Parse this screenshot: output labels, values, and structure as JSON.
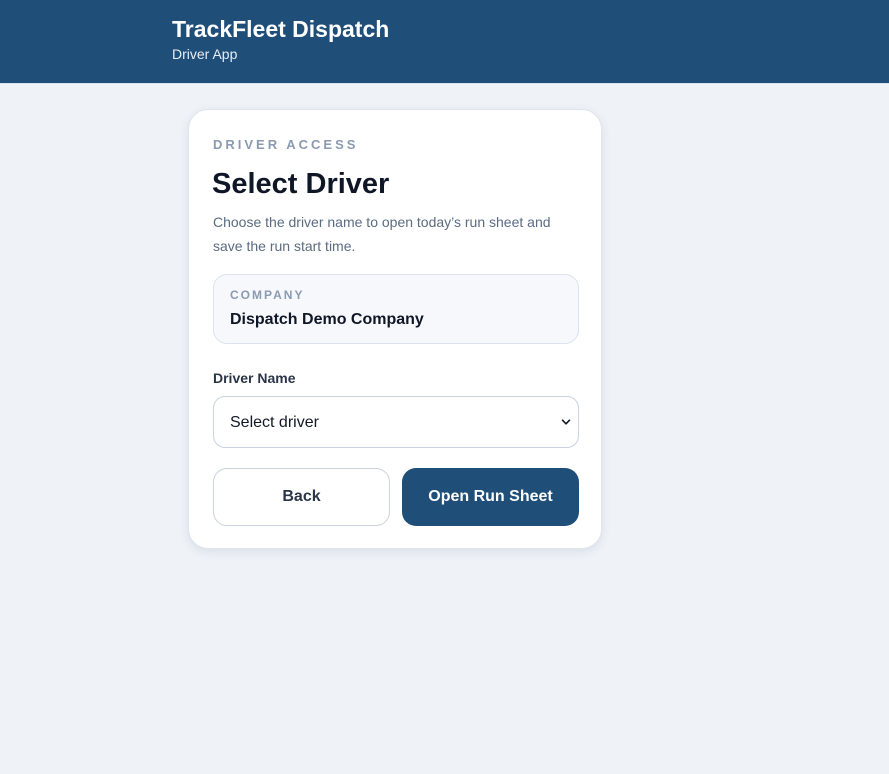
{
  "header": {
    "title": "TrackFleet Dispatch",
    "subtitle": "Driver App"
  },
  "card": {
    "eyebrow": "DRIVER ACCESS",
    "title": "Select Driver",
    "description": "Choose the driver name to open today’s run sheet and save the run start time.",
    "company": {
      "label": "COMPANY",
      "name": "Dispatch Demo Company"
    },
    "driver_field": {
      "label": "Driver Name",
      "selected_value": "Select driver",
      "icon": "chevron-down-icon"
    },
    "buttons": {
      "back_label": "Back",
      "open_label": "Open Run Sheet"
    }
  },
  "colors": {
    "brand": "#1f4e79",
    "page_background": "#eff3f8",
    "card_background": "#ffffff",
    "muted_text": "#8a9ab0"
  }
}
